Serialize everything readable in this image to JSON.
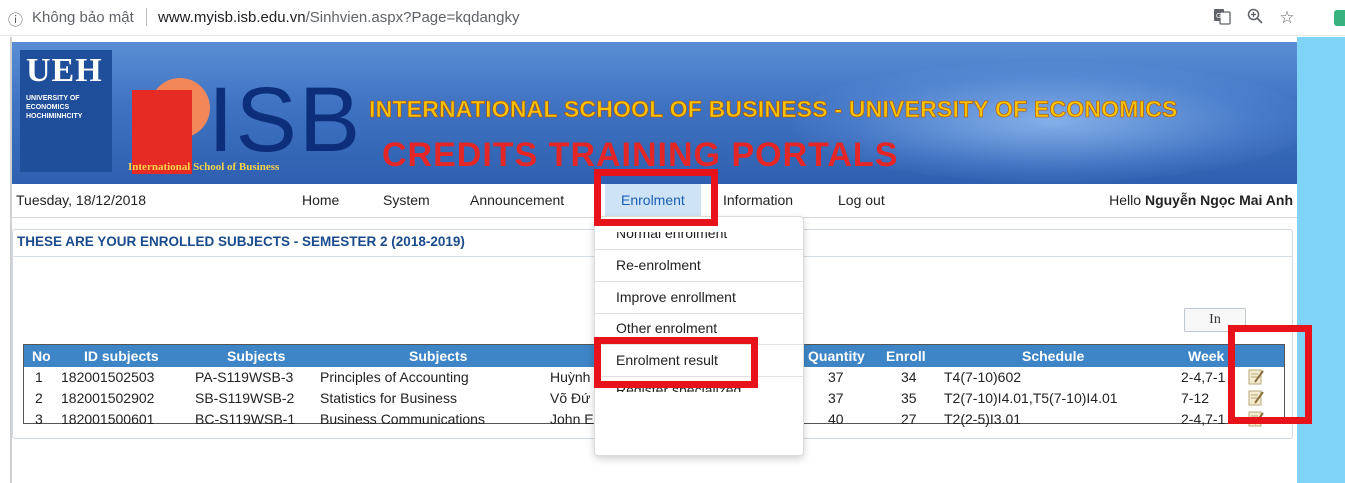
{
  "browser": {
    "info_icon": "info-circle-icon",
    "security_label": "Không bảo mật",
    "url_host": "www.myisb.isb.edu.vn",
    "url_path": "/Sinhvien.aspx?Page=kqdangky",
    "toolbar_icons": [
      "translate-icon",
      "zoom-icon",
      "star-icon",
      "extension-icon"
    ]
  },
  "banner": {
    "ueh_title": "UEH",
    "ueh_subtitle": "UNIVERSITY OF ECONOMICS HOCHIMINHCITY",
    "isb_logo": "ISB",
    "isb_tagline": "International School of Business",
    "line1": "INTERNATIONAL SCHOOL OF BUSINESS - UNIVERSITY OF ECONOMICS",
    "line2": "CREDITS TRAINING PORTALS"
  },
  "nav": {
    "date": "Tuesday, 18/12/2018",
    "items": [
      "Home",
      "System",
      "Announcement",
      "Enrolment",
      "Information",
      "Log out"
    ],
    "greeting": "Hello",
    "user_name": "Nguyễn Ngọc Mai Anh",
    "active_item": "Enrolment"
  },
  "dropdown": {
    "items": [
      "Normal enrolment",
      "Re-enrolment",
      "Improve enrollment",
      "Other enrolment",
      "Enrolment result",
      "Register specialized"
    ]
  },
  "panel": {
    "title": "THESE ARE YOUR ENROLLED SUBJECTS - SEMESTER 2 (2018-2019)",
    "print_button": "In"
  },
  "table": {
    "headers": [
      "No",
      "ID subjects",
      "Subjects",
      "Subjects",
      "Quantity",
      "Enroll",
      "Schedule",
      "Week"
    ],
    "rows": [
      {
        "no": "1",
        "id": "182001502503",
        "code": "PA-S119WSB-3",
        "name": "Principles of Accounting",
        "lecturer": "Huỳnh",
        "quantity": "37",
        "enroll": "34",
        "schedule": "T4(7-10)602",
        "week": "2-4,7-1"
      },
      {
        "no": "2",
        "id": "182001502902",
        "code": "SB-S119WSB-2",
        "name": "Statistics for Business",
        "lecturer": "Võ Đứ",
        "quantity": "37",
        "enroll": "35",
        "schedule": "T2(7-10)I4.01,T5(7-10)I4.01",
        "week": "7-12"
      },
      {
        "no": "3",
        "id": "182001500601",
        "code": "BC-S119WSB-1",
        "name": "Business Communications",
        "lecturer": "John E",
        "quantity": "40",
        "enroll": "27",
        "schedule": "T2(2-5)I3.01",
        "week": "2-4,7-1"
      }
    ],
    "row_icon": "edit-note-icon"
  },
  "colors": {
    "table_header": "#3d85c6",
    "annotation_red": "#e8121b",
    "banner_yellow": "#f7c500",
    "banner_red": "#e42626",
    "title_blue": "#1a4b8c"
  }
}
